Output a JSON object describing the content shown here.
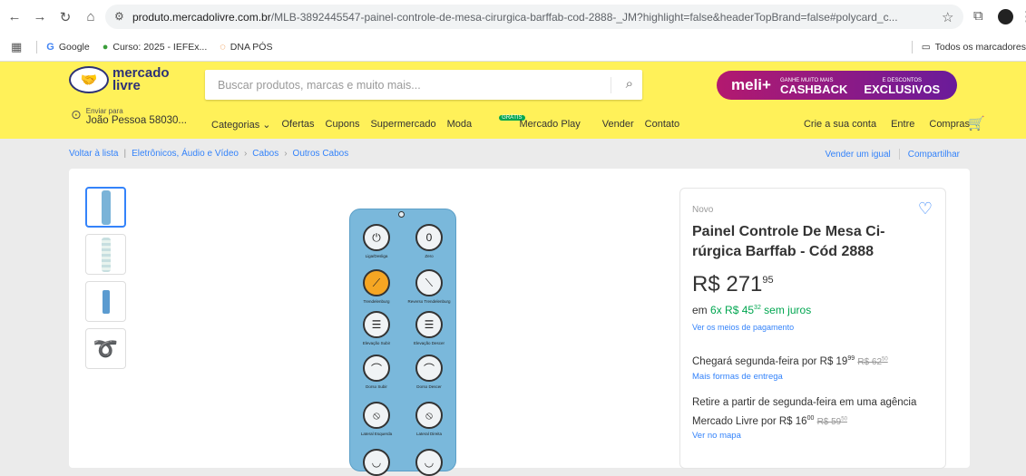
{
  "browser": {
    "url_domain": "produto.mercadolivre.com.br",
    "url_rest": "/MLB-3892445547-painel-controle-de-mesa-cirurgica-barffab-cod-2888-_JM?highlight=false&headerTopBrand=false#polycard_c...",
    "bookmarks": [
      "Google",
      "Curso: 2025 - IEFEx...",
      "DNA PÓS"
    ],
    "all_bookmarks": "Todos os marcadores"
  },
  "header": {
    "logo_line1": "mercado",
    "logo_line2": "livre",
    "search_placeholder": "Buscar produtos, marcas e muito mais...",
    "meli_logo": "meli+",
    "meli_small1": "GANHE MUITO MAIS",
    "meli_big1": "CASHBACK",
    "meli_small2": "E DESCONTOS",
    "meli_big2": "EXCLUSIVOS",
    "addr_small": "Enviar para",
    "addr_big": "João Pessoa 58030...",
    "nav": [
      "Categorias ⌄",
      "Ofertas",
      "Cupons",
      "Supermercado",
      "Moda",
      "Mercado Play",
      "Vender",
      "Contato"
    ],
    "mp_badge": "GRÁTIS",
    "right_nav": [
      "Crie a sua conta",
      "Entre",
      "Compras"
    ]
  },
  "breadcrumb": {
    "back": "Voltar à lista",
    "path": [
      "Eletrônicos, Áudio e Vídeo",
      "Cabos",
      "Outros Cabos"
    ],
    "sell_same": "Vender um igual",
    "share": "Compartilhar"
  },
  "product": {
    "condition": "Novo",
    "title": "Painel Controle De Mesa Ci-rúrgica Barffab - Cód 2888",
    "price_int": "R$ 271",
    "price_cents": "95",
    "inst_prefix": "em ",
    "inst_value": "6x R$ 45",
    "inst_cents": "32",
    "inst_suffix": " sem juros",
    "meios": "Ver os meios de pagamento",
    "ship_text": "Chegará segunda-feira por R$ 19",
    "ship_cents": "99",
    "ship_old": "R$ 62",
    "ship_old_cents": "50",
    "more_ship": "Mais formas de entrega",
    "pickup_text": "Retire a partir de segunda-feira em uma agência Mercado Livre por R$ 16",
    "pickup_cents": "00",
    "pickup_old": "R$ 59",
    "pickup_old_cents": "50",
    "map": "Ver no mapa"
  },
  "panel_labels": [
    "Liga/Desliga",
    "Zero",
    "Trendelenburg",
    "Reverso Trendelenburg",
    "Elevação Subir",
    "Elevação Descer",
    "Dorso Subir",
    "Dorso Descer",
    "Lateral Esquerda",
    "Lateral Direita"
  ],
  "colors": {
    "yellow": "#fff159",
    "blue_link": "#3483fa",
    "green": "#00a650"
  }
}
